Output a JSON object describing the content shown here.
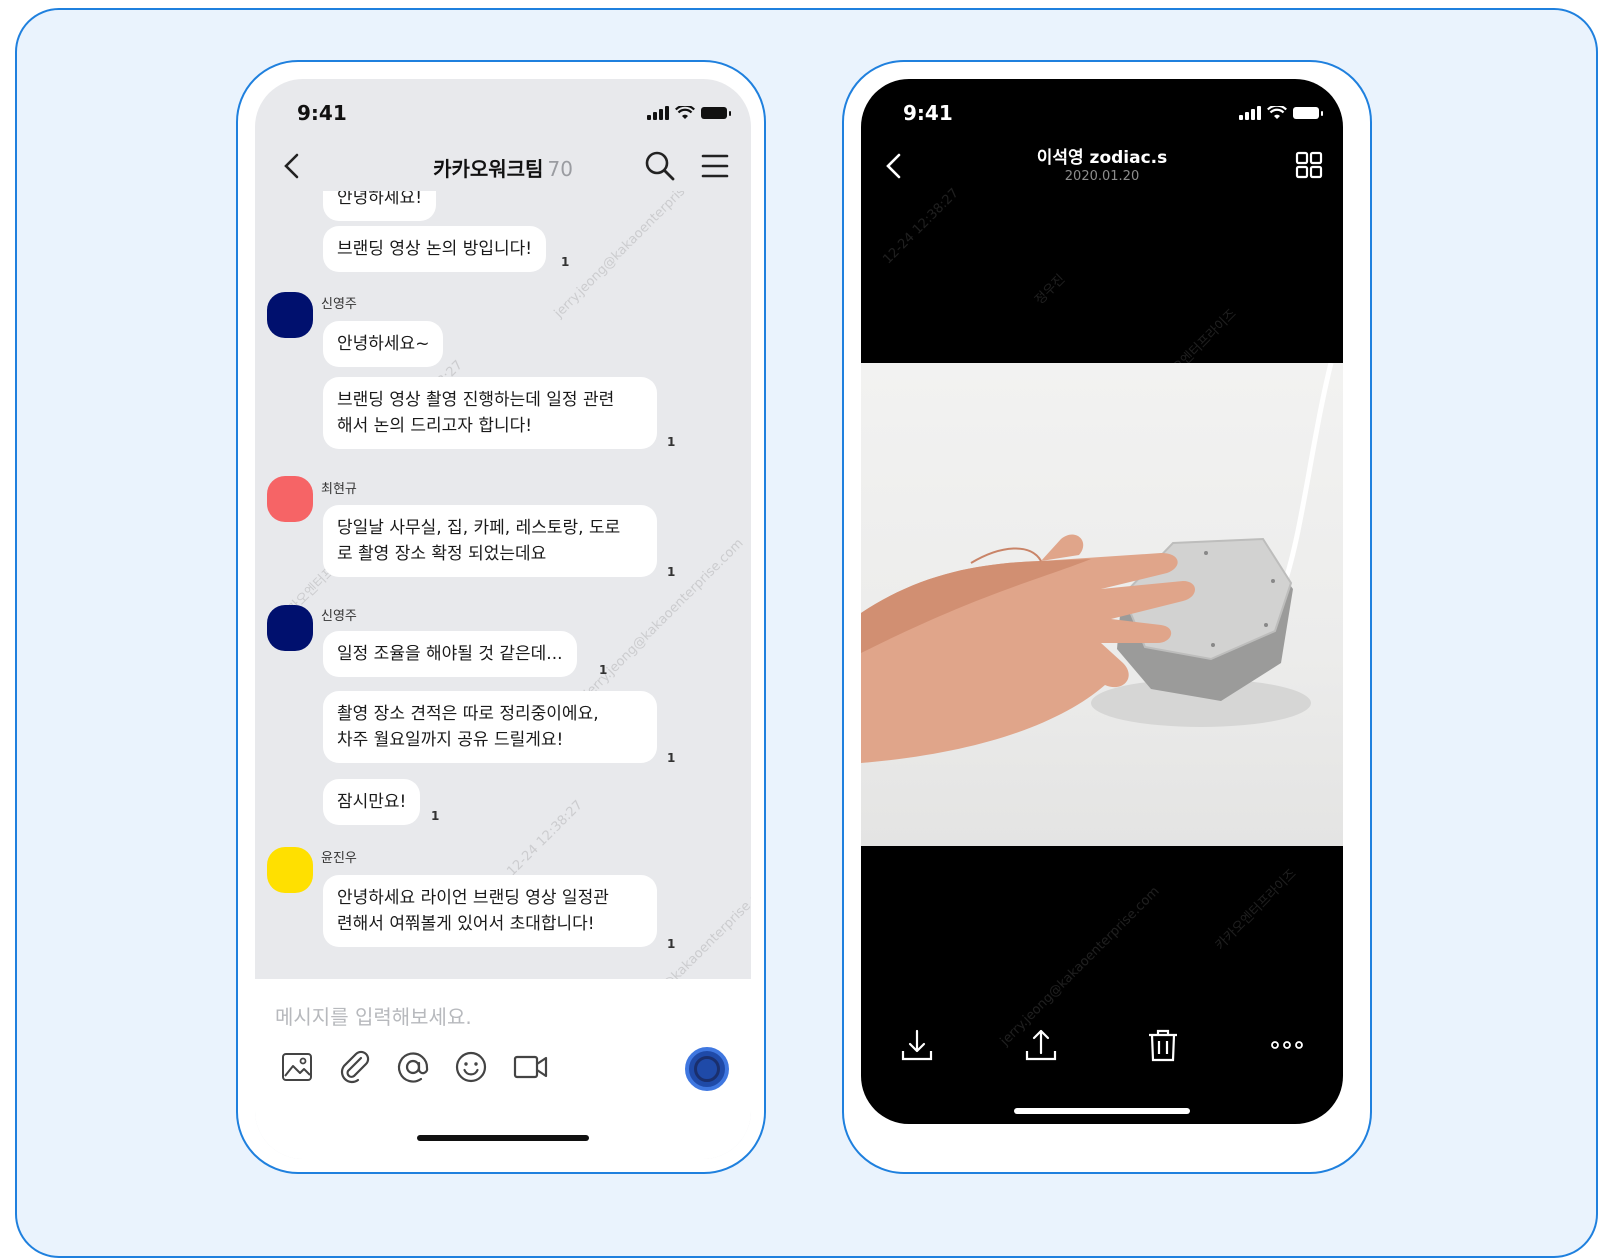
{
  "chat": {
    "status_time": "9:41",
    "header": {
      "title": "카카오워크팀",
      "member_count": "70"
    },
    "messages": [
      {
        "type": "bubble",
        "text": "안녕하세요!",
        "read": ""
      },
      {
        "type": "bubble",
        "text": "브랜딩 영상 논의 방입니다!",
        "read": "1"
      },
      {
        "type": "sender",
        "name": "신영주",
        "avatar_color": "#00106e"
      },
      {
        "type": "bubble",
        "text": "안녕하세요~",
        "read": ""
      },
      {
        "type": "bubble",
        "text_lines": [
          "브랜딩 영상 촬영 진행하는데 일정 관련",
          "해서 논의 드리고자 합니다!"
        ],
        "read": "1"
      },
      {
        "type": "sender",
        "name": "최현규",
        "avatar_color": "#f66466"
      },
      {
        "type": "bubble",
        "text_lines": [
          "당일날 사무실, 집, 카페, 레스토랑, 도로",
          "로 촬영 장소 확정 되었는데요"
        ],
        "read": "1"
      },
      {
        "type": "sender",
        "name": "신영주",
        "avatar_color": "#00106e"
      },
      {
        "type": "bubble",
        "text": "일정 조율을 해야될 것 같은데...",
        "read": "1"
      },
      {
        "type": "bubble",
        "text_lines": [
          "촬영 장소 견적은 따로 정리중이에요,",
          "차주 월요일까지 공유 드릴게요!"
        ],
        "read": "1"
      },
      {
        "type": "bubble",
        "text": "잠시만요!",
        "read": "1"
      },
      {
        "type": "sender",
        "name": "윤진우",
        "avatar_color": "#ffe000"
      },
      {
        "type": "bubble",
        "text_lines": [
          "안녕하세요 라이언 브랜딩 영상 일정관",
          "련해서 여쭤볼게 있어서 초대합니다!"
        ],
        "read": "1"
      }
    ],
    "composer": {
      "placeholder": "메시지를 입력해보세요.",
      "tools": [
        "image-icon",
        "paperclip-icon",
        "mention-icon",
        "emoji-icon",
        "video-icon"
      ],
      "send_icon": "send-circle-icon"
    }
  },
  "photo_viewer": {
    "status_time": "9:41",
    "title": "이석영 zodiac.s",
    "date": "2020.01.20",
    "grid_icon": "grid-icon",
    "photo_description": "hand touching grey speaker device",
    "tools": [
      "download-icon",
      "share-icon",
      "trash-icon",
      "more-icon"
    ]
  },
  "watermark": {
    "texts": [
      "jerry.jeong@kakaoenterprise.com",
      "정우진",
      "카카오엔터프라이즈",
      "12-24 12:38:27"
    ]
  },
  "colors": {
    "accent": "#1f80de",
    "card_bg": "#eaf3fd",
    "chat_bg": "#e8e9ec"
  }
}
